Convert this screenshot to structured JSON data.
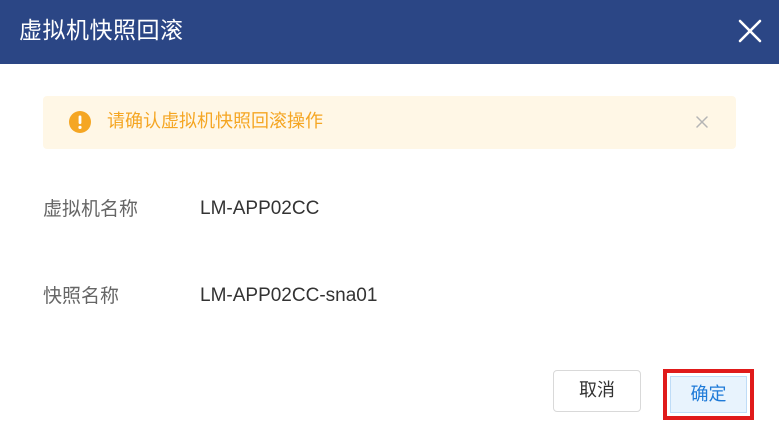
{
  "dialog": {
    "title": "虚拟机快照回滚",
    "close_icon": "close-icon"
  },
  "alert": {
    "icon": "warning-circle-icon",
    "message": "请确认虚拟机快照回滚操作",
    "close_icon": "close-icon",
    "color": "#f5a623",
    "background": "#fff7e6"
  },
  "fields": {
    "vm_name_label": "虚拟机名称",
    "vm_name_value": "LM-APP02CC",
    "snapshot_name_label": "快照名称",
    "snapshot_name_value": "LM-APP02CC-sna01"
  },
  "buttons": {
    "cancel_label": "取消",
    "confirm_label": "确定"
  },
  "colors": {
    "header_bg": "#2b4685",
    "highlight_border": "#e01a1a",
    "confirm_text": "#1e7ad8"
  }
}
